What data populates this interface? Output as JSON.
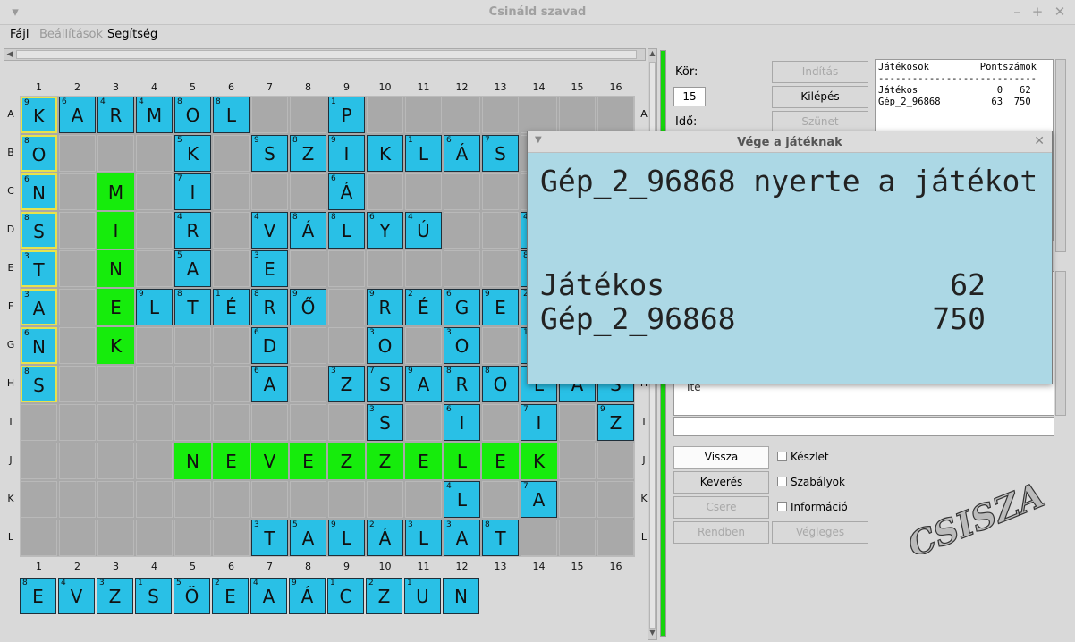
{
  "window": {
    "title": "Csináld szavad",
    "controls": [
      "▾",
      "–",
      "+",
      "✕"
    ]
  },
  "menu": {
    "file": "Fájl",
    "settings": "Beállítások",
    "help": "Segítség"
  },
  "board": {
    "columns": [
      "1",
      "2",
      "3",
      "4",
      "5",
      "6",
      "7",
      "8",
      "9",
      "10",
      "11",
      "12",
      "13",
      "14",
      "15",
      "16"
    ],
    "rows": [
      "A",
      "B",
      "C",
      "D",
      "E",
      "F",
      "G",
      "H",
      "I",
      "J",
      "K",
      "L"
    ],
    "tiles": [
      {
        "r": 0,
        "c": 0,
        "l": "K",
        "p": "9",
        "hl": true
      },
      {
        "r": 0,
        "c": 1,
        "l": "A",
        "p": "6"
      },
      {
        "r": 0,
        "c": 2,
        "l": "R",
        "p": "4"
      },
      {
        "r": 0,
        "c": 3,
        "l": "M",
        "p": "4"
      },
      {
        "r": 0,
        "c": 4,
        "l": "O",
        "p": "8"
      },
      {
        "r": 0,
        "c": 5,
        "l": "L",
        "p": "8"
      },
      {
        "r": 0,
        "c": 8,
        "l": "P",
        "p": "1"
      },
      {
        "r": 1,
        "c": 0,
        "l": "O",
        "p": "8",
        "hl": true
      },
      {
        "r": 1,
        "c": 4,
        "l": "K",
        "p": "5"
      },
      {
        "r": 1,
        "c": 6,
        "l": "S",
        "p": "9"
      },
      {
        "r": 1,
        "c": 7,
        "l": "Z",
        "p": "8"
      },
      {
        "r": 1,
        "c": 8,
        "l": "I",
        "p": "9"
      },
      {
        "r": 1,
        "c": 9,
        "l": "K",
        "p": ""
      },
      {
        "r": 1,
        "c": 10,
        "l": "L",
        "p": "1"
      },
      {
        "r": 1,
        "c": 11,
        "l": "Á",
        "p": "6"
      },
      {
        "r": 1,
        "c": 12,
        "l": "S",
        "p": "7"
      },
      {
        "r": 2,
        "c": 0,
        "l": "N",
        "p": "6",
        "hl": true
      },
      {
        "r": 2,
        "c": 2,
        "l": "M",
        "p": "",
        "new": true
      },
      {
        "r": 2,
        "c": 4,
        "l": "I",
        "p": "7"
      },
      {
        "r": 2,
        "c": 8,
        "l": "Á",
        "p": "6"
      },
      {
        "r": 3,
        "c": 0,
        "l": "S",
        "p": "8",
        "hl": true
      },
      {
        "r": 3,
        "c": 2,
        "l": "I",
        "p": "",
        "new": true
      },
      {
        "r": 3,
        "c": 4,
        "l": "R",
        "p": "4"
      },
      {
        "r": 3,
        "c": 6,
        "l": "V",
        "p": "4"
      },
      {
        "r": 3,
        "c": 7,
        "l": "Á",
        "p": "8"
      },
      {
        "r": 3,
        "c": 8,
        "l": "L",
        "p": "8"
      },
      {
        "r": 3,
        "c": 9,
        "l": "Y",
        "p": "6"
      },
      {
        "r": 3,
        "c": 10,
        "l": "Ú",
        "p": "4"
      },
      {
        "r": 3,
        "c": 13,
        "l": "",
        "p": "4"
      },
      {
        "r": 4,
        "c": 0,
        "l": "T",
        "p": "3",
        "hl": true
      },
      {
        "r": 4,
        "c": 2,
        "l": "N",
        "p": "",
        "new": true
      },
      {
        "r": 4,
        "c": 4,
        "l": "A",
        "p": "5"
      },
      {
        "r": 4,
        "c": 6,
        "l": "E",
        "p": "3"
      },
      {
        "r": 4,
        "c": 13,
        "l": "",
        "p": "8"
      },
      {
        "r": 5,
        "c": 0,
        "l": "A",
        "p": "3",
        "hl": true
      },
      {
        "r": 5,
        "c": 2,
        "l": "E",
        "p": "",
        "new": true
      },
      {
        "r": 5,
        "c": 3,
        "l": "L",
        "p": "9"
      },
      {
        "r": 5,
        "c": 4,
        "l": "T",
        "p": "8"
      },
      {
        "r": 5,
        "c": 5,
        "l": "É",
        "p": "1"
      },
      {
        "r": 5,
        "c": 6,
        "l": "R",
        "p": "8"
      },
      {
        "r": 5,
        "c": 7,
        "l": "Ő",
        "p": "9"
      },
      {
        "r": 5,
        "c": 9,
        "l": "R",
        "p": "9"
      },
      {
        "r": 5,
        "c": 10,
        "l": "É",
        "p": "2"
      },
      {
        "r": 5,
        "c": 11,
        "l": "G",
        "p": "6"
      },
      {
        "r": 5,
        "c": 12,
        "l": "E",
        "p": "9"
      },
      {
        "r": 5,
        "c": 13,
        "l": "",
        "p": "2"
      },
      {
        "r": 6,
        "c": 0,
        "l": "N",
        "p": "6",
        "hl": true
      },
      {
        "r": 6,
        "c": 2,
        "l": "K",
        "p": "",
        "new": true
      },
      {
        "r": 6,
        "c": 6,
        "l": "D",
        "p": "6"
      },
      {
        "r": 6,
        "c": 9,
        "l": "O",
        "p": "3"
      },
      {
        "r": 6,
        "c": 11,
        "l": "O",
        "p": "3"
      },
      {
        "r": 6,
        "c": 13,
        "l": "",
        "p": "1"
      },
      {
        "r": 7,
        "c": 0,
        "l": "S",
        "p": "8",
        "hl": true
      },
      {
        "r": 7,
        "c": 6,
        "l": "A",
        "p": "6"
      },
      {
        "r": 7,
        "c": 8,
        "l": "Z",
        "p": "3"
      },
      {
        "r": 7,
        "c": 9,
        "l": "S",
        "p": "7"
      },
      {
        "r": 7,
        "c": 10,
        "l": "A",
        "p": "9"
      },
      {
        "r": 7,
        "c": 11,
        "l": "R",
        "p": "8"
      },
      {
        "r": 7,
        "c": 12,
        "l": "O",
        "p": "8"
      },
      {
        "r": 7,
        "c": 13,
        "l": "L",
        "p": ""
      },
      {
        "r": 7,
        "c": 14,
        "l": "A",
        "p": ""
      },
      {
        "r": 7,
        "c": 15,
        "l": "S",
        "p": ""
      },
      {
        "r": 8,
        "c": 9,
        "l": "S",
        "p": "3"
      },
      {
        "r": 8,
        "c": 11,
        "l": "I",
        "p": "6"
      },
      {
        "r": 8,
        "c": 13,
        "l": "I",
        "p": "7"
      },
      {
        "r": 8,
        "c": 15,
        "l": "Z",
        "p": "9"
      },
      {
        "r": 9,
        "c": 4,
        "l": "N",
        "p": "",
        "new": true
      },
      {
        "r": 9,
        "c": 5,
        "l": "E",
        "p": "",
        "new": true
      },
      {
        "r": 9,
        "c": 6,
        "l": "V",
        "p": "",
        "new": true
      },
      {
        "r": 9,
        "c": 7,
        "l": "E",
        "p": "",
        "new": true
      },
      {
        "r": 9,
        "c": 8,
        "l": "Z",
        "p": "",
        "new": true
      },
      {
        "r": 9,
        "c": 9,
        "l": "Z",
        "p": "",
        "new": true
      },
      {
        "r": 9,
        "c": 10,
        "l": "E",
        "p": "",
        "new": true
      },
      {
        "r": 9,
        "c": 11,
        "l": "L",
        "p": "",
        "new": true
      },
      {
        "r": 9,
        "c": 12,
        "l": "E",
        "p": "",
        "new": true
      },
      {
        "r": 9,
        "c": 13,
        "l": "K",
        "p": "",
        "new": true
      },
      {
        "r": 10,
        "c": 11,
        "l": "L",
        "p": "4"
      },
      {
        "r": 10,
        "c": 13,
        "l": "A",
        "p": "7"
      },
      {
        "r": 11,
        "c": 6,
        "l": "T",
        "p": "3"
      },
      {
        "r": 11,
        "c": 7,
        "l": "A",
        "p": "5"
      },
      {
        "r": 11,
        "c": 8,
        "l": "L",
        "p": "9"
      },
      {
        "r": 11,
        "c": 9,
        "l": "Á",
        "p": "2"
      },
      {
        "r": 11,
        "c": 10,
        "l": "L",
        "p": "3"
      },
      {
        "r": 11,
        "c": 11,
        "l": "A",
        "p": "3"
      },
      {
        "r": 11,
        "c": 12,
        "l": "T",
        "p": "8"
      }
    ]
  },
  "rack": [
    {
      "l": "E",
      "p": "8"
    },
    {
      "l": "V",
      "p": "4"
    },
    {
      "l": "Z",
      "p": "3"
    },
    {
      "l": "S",
      "p": "1"
    },
    {
      "l": "Ö",
      "p": "5"
    },
    {
      "l": "E",
      "p": "2"
    },
    {
      "l": "A",
      "p": "4"
    },
    {
      "l": "Á",
      "p": "9"
    },
    {
      "l": "C",
      "p": "1"
    },
    {
      "l": "Z",
      "p": "2"
    },
    {
      "l": "U",
      "p": "1"
    },
    {
      "l": "N",
      "p": ""
    }
  ],
  "side": {
    "round_label": "Kör:",
    "round_value": "15",
    "time_label": "Idő:",
    "btn_start": "Indítás",
    "btn_exit": "Kilépés",
    "btn_pause": "Szünet",
    "btn_back": "Vissza",
    "btn_shuffle": "Keverés",
    "btn_swap": "Csere",
    "btn_ok": "Rendben",
    "btn_final": "Végleges",
    "chk_set": "Készlet",
    "chk_rules": "Szabályok",
    "chk_info": "Információ",
    "players_text": "Játékosok         Pontszámok\n----------------------------\nJátékos              0   62\nGép_2_96868         63  750",
    "log_tail": "Íté_",
    "logo": "CSISZA"
  },
  "dialog": {
    "title": "Vége a játéknak",
    "message": "Gép_2_96868 nyerte a játékot",
    "results": [
      {
        "name": "Játékos",
        "score": "62"
      },
      {
        "name": "Gép_2_96868",
        "score": "750"
      }
    ]
  },
  "colors": {
    "tile": "#29c0e6",
    "new_tile": "#16ec0c",
    "highlight": "#e7e24d",
    "dialog_bg": "#acd8e5"
  }
}
